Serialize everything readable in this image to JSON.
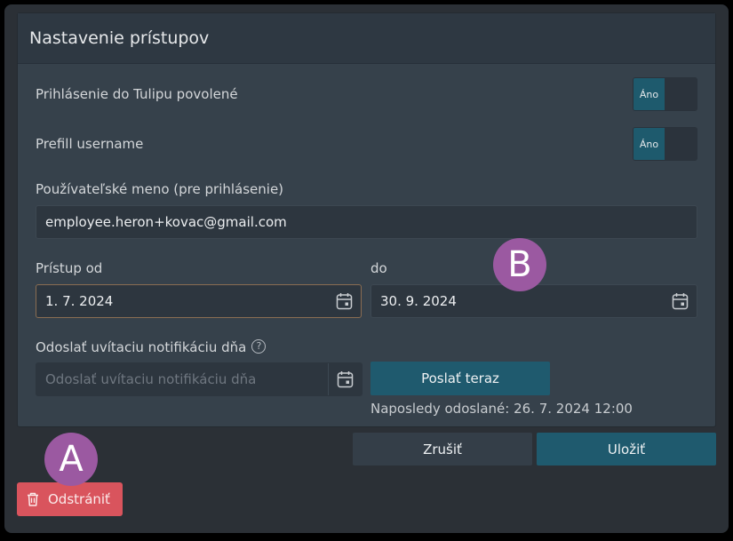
{
  "dialog": {
    "title": "Nastavenie prístupov"
  },
  "login_enabled": {
    "label": "Prihlásenie do Tulipu povolené",
    "toggle_label": "Áno"
  },
  "prefill_username": {
    "label": "Prefill username",
    "toggle_label": "Áno"
  },
  "username": {
    "label": "Používateľské meno (pre prihlásenie)",
    "value": "employee.heron+kovac@gmail.com"
  },
  "access_from": {
    "label": "Prístup od",
    "value": "1. 7. 2024"
  },
  "access_to": {
    "label": "do",
    "value": "30. 9. 2024"
  },
  "welcome_notification": {
    "label": "Odoslať uvítaciu notifikáciu dňa",
    "help": "?",
    "placeholder": "Odoslať uvítaciu notifikáciu dňa",
    "send_now_label": "Poslať teraz",
    "last_sent": "Naposledy odoslané: 26. 7. 2024 12:00"
  },
  "footer": {
    "cancel_label": "Zrušiť",
    "save_label": "Uložiť",
    "delete_label": "Odstrániť"
  },
  "annotations": {
    "a": "A",
    "b": "B"
  },
  "icons": {
    "calendar": "calendar-icon",
    "trash": "trash-icon",
    "help": "question-circle-icon"
  },
  "colors": {
    "primary": "#1f5a6e",
    "danger": "#d9545d",
    "badge": "#9b59a1"
  }
}
